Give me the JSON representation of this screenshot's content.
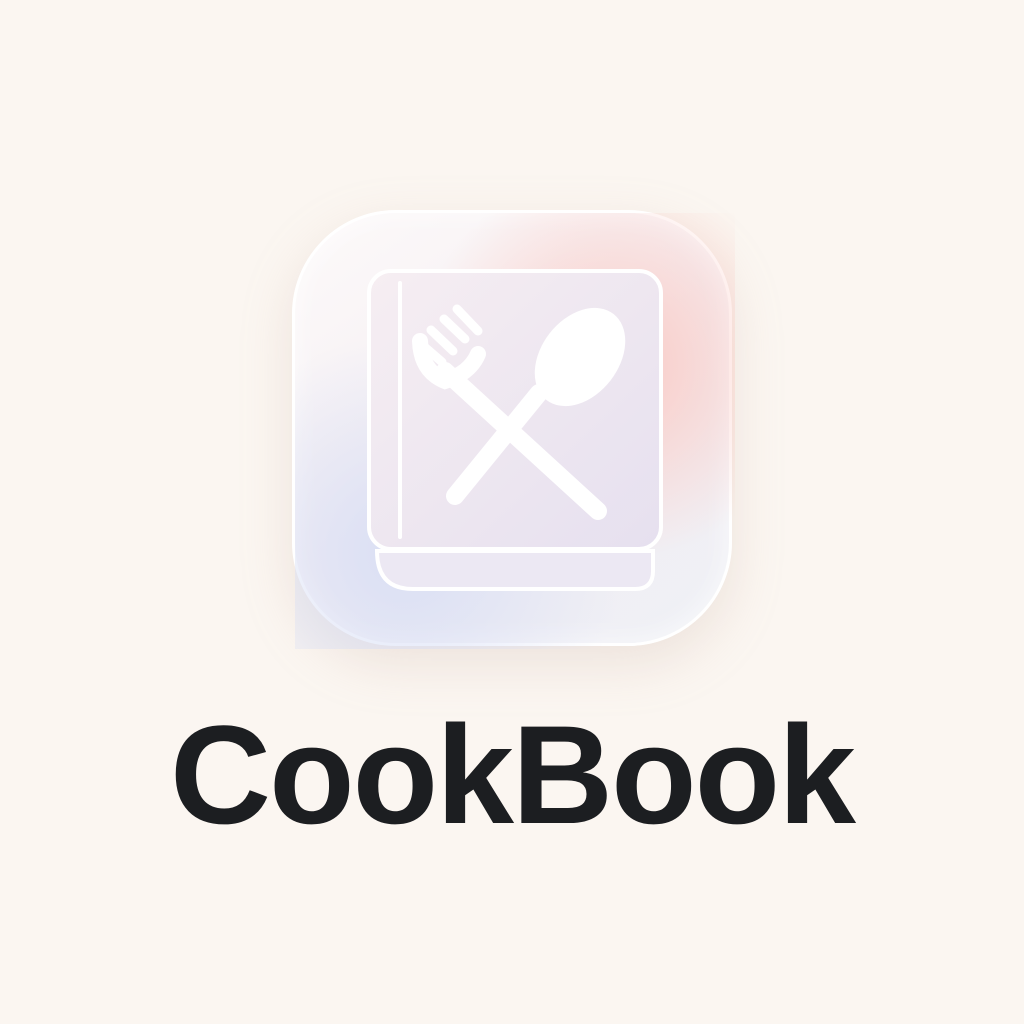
{
  "app": {
    "title": "CookBook",
    "icon": "cookbook-fork-spoon-icon"
  },
  "colors": {
    "background": "#fbf6f1",
    "title": "#1c1e21",
    "tile_glow_pink": "#f9c9c4",
    "tile_glow_blue": "#d9def3"
  }
}
